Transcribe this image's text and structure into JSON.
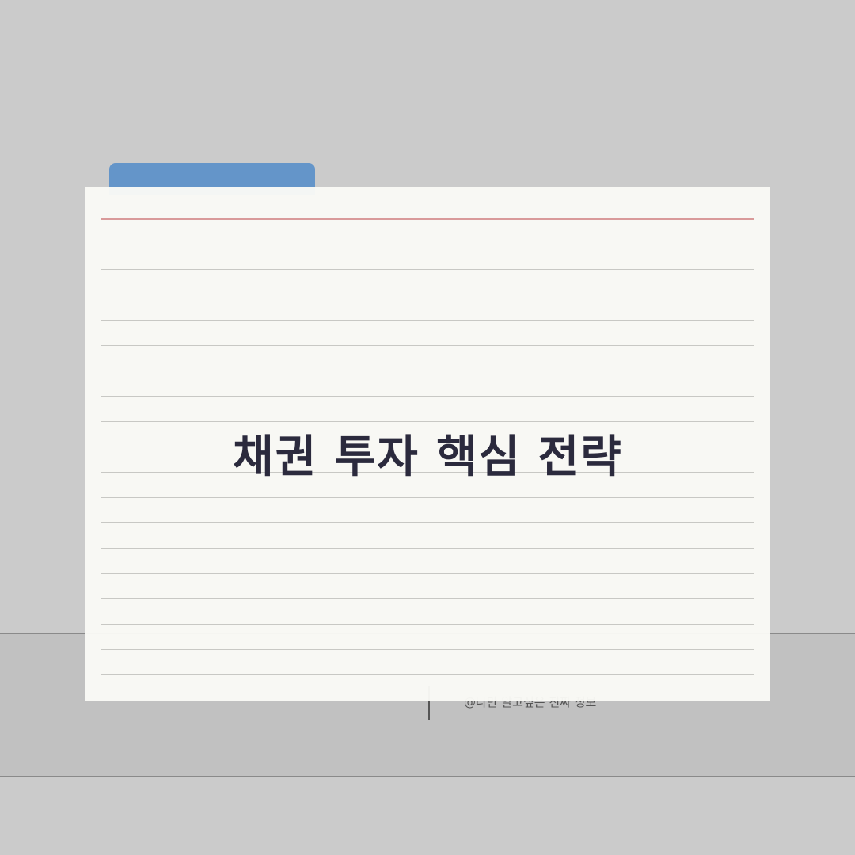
{
  "card": {
    "title": "채권 투자 핵심 전략"
  },
  "footer": {
    "credit": "@나만 알고싶은 진짜 정보"
  },
  "colors": {
    "background": "#cbcbcb",
    "tab": "#6495c9",
    "card": "#fafaf6",
    "title": "#2b2a3d",
    "margin_rule": "#d99a9a"
  }
}
